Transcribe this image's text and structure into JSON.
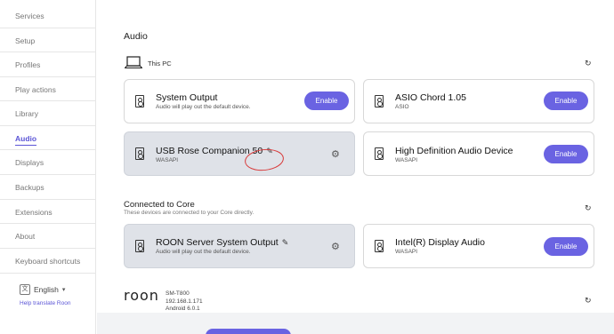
{
  "sidebar": {
    "items": [
      {
        "label": "Services"
      },
      {
        "label": "Setup"
      },
      {
        "label": "Profiles"
      },
      {
        "label": "Play actions"
      },
      {
        "label": "Library"
      },
      {
        "label": "Audio",
        "active": true
      },
      {
        "label": "Displays"
      },
      {
        "label": "Backups"
      },
      {
        "label": "Extensions"
      },
      {
        "label": "About"
      },
      {
        "label": "Keyboard shortcuts"
      }
    ],
    "language": "English",
    "help_link": "Help translate Roon"
  },
  "main": {
    "title": "Audio",
    "this_pc": {
      "label": "This PC",
      "devices": [
        {
          "name": "System Output",
          "sub": "Audio will play out the default device.",
          "button": "Enable"
        },
        {
          "name": "ASIO Chord  1.05",
          "sub": "ASIO",
          "button": "Enable"
        },
        {
          "name": "USB Rose Companion 50",
          "sub": "WASAPI"
        },
        {
          "name": "High Definition Audio Device",
          "sub": "WASAPI",
          "button": "Enable"
        }
      ]
    },
    "connected": {
      "title": "Connected to Core",
      "subtitle": "These devices are connected to your Core directly.",
      "devices": [
        {
          "name": "ROON Server System Output",
          "sub": "Audio will play out the default device."
        },
        {
          "name": "Intel(R) Display Audio",
          "sub": "WASAPI",
          "button": "Enable"
        }
      ]
    },
    "roon_device": {
      "logo": "roon",
      "model": "SM-T800",
      "ip": "192.168.1.171",
      "os": "Android 6.0.1"
    }
  },
  "colors": {
    "accent": "#6a63e2",
    "active_nav": "#5b55d6",
    "annotation": "#d83a3a",
    "enabled_card": "#dfe2e8"
  },
  "icons": {
    "refresh": "refresh-icon",
    "speaker": "speaker-icon",
    "gear": "gear-icon",
    "pencil": "pencil-icon",
    "laptop": "laptop-icon"
  }
}
